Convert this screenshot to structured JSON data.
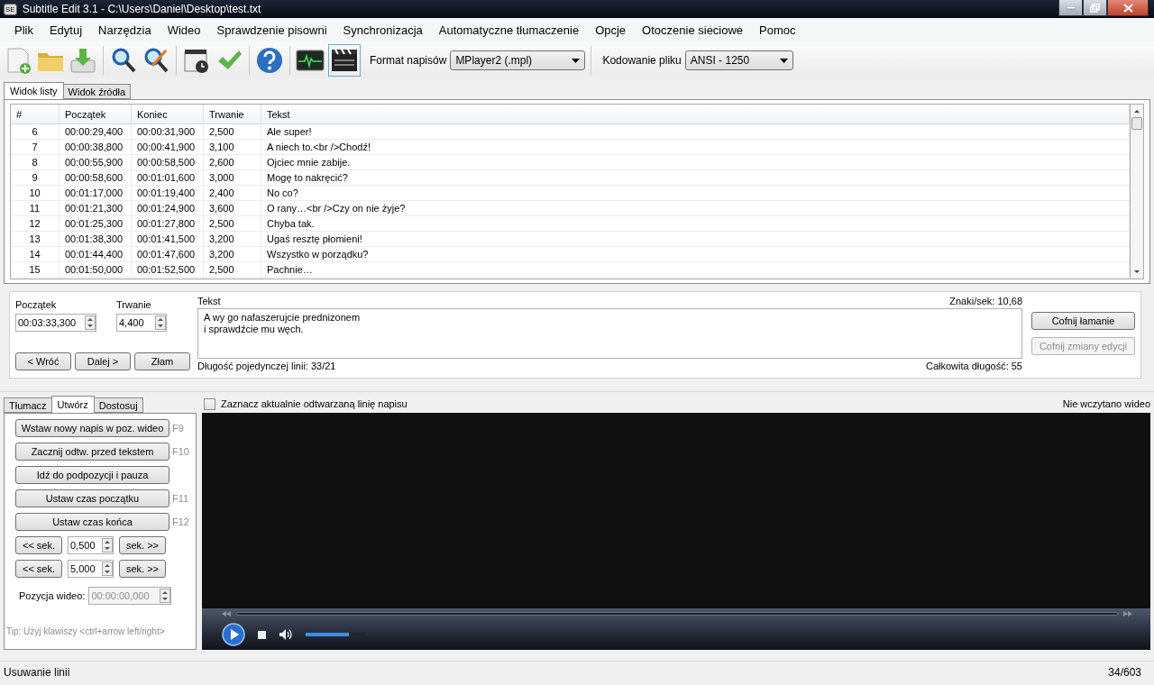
{
  "window": {
    "app_icon": "SE",
    "title": "Subtitle Edit 3.1 - C:\\Users\\Daniel\\Desktop\\test.txt"
  },
  "menu": [
    "Plik",
    "Edytuj",
    "Narzędzia",
    "Wideo",
    "Sprawdzenie pisowni",
    "Synchronizacja",
    "Automatyczne tłumaczenie",
    "Opcje",
    "Otoczenie sieciowe",
    "Pomoc"
  ],
  "toolbar": {
    "format_label": "Format napisów",
    "format_value": "MPlayer2 (.mpl)",
    "encoding_label": "Kodowanie pliku",
    "encoding_value": "ANSI - 1250"
  },
  "view_tabs": [
    {
      "label": "Widok listy",
      "selected": true
    },
    {
      "label": "Widok źródła",
      "selected": false
    }
  ],
  "table": {
    "columns": [
      "#",
      "Początek",
      "Koniec",
      "Trwanie",
      "Tekst"
    ],
    "rows": [
      [
        "6",
        "00:00:29,400",
        "00:00:31,900",
        "2,500",
        "Ale super!"
      ],
      [
        "7",
        "00:00:38,800",
        "00:00:41,900",
        "3,100",
        "A niech to.<br />Chodź!"
      ],
      [
        "8",
        "00:00:55,900",
        "00:00:58,500",
        "2,600",
        "Ojciec mnie zabije."
      ],
      [
        "9",
        "00:00:58,600",
        "00:01:01,600",
        "3,000",
        "Mogę to nakręcić?"
      ],
      [
        "10",
        "00:01:17,000",
        "00:01:19,400",
        "2,400",
        "No co?"
      ],
      [
        "11",
        "00:01:21,300",
        "00:01:24,900",
        "3,600",
        "O rany…<br />Czy on nie żyje?"
      ],
      [
        "12",
        "00:01:25,300",
        "00:01:27,800",
        "2,500",
        "Chyba tak."
      ],
      [
        "13",
        "00:01:38,300",
        "00:01:41,500",
        "3,200",
        "Ugaś resztę płomieni!"
      ],
      [
        "14",
        "00:01:44,400",
        "00:01:47,600",
        "3,200",
        "Wszystko w porządku?"
      ],
      [
        "15",
        "00:01:50,000",
        "00:01:52,500",
        "2,500",
        "Pachnie…"
      ]
    ]
  },
  "editor": {
    "start_label": "Początek",
    "start_value": "00:03:33,300",
    "duration_label": "Trwanie",
    "duration_value": "4,400",
    "text_label": "Tekst",
    "chars_per_sec": "Znaki/sek: 10,68",
    "text_value": "A wy go nafaszerujcie prednizonem\ni sprawdźcie mu węch.",
    "line_lengths": "Długość pojedynczej linii: 33/21",
    "total_length": "Całkowita długość: 55",
    "nav_buttons": [
      "< Wróć",
      "Dalej >",
      "Złam"
    ],
    "side_buttons": [
      {
        "label": "Cofnij łamanie",
        "disabled": false
      },
      {
        "label": "Cofnij zmiany edycji",
        "disabled": true
      }
    ]
  },
  "tool_tabs": [
    {
      "label": "Tłumacz",
      "selected": false
    },
    {
      "label": "Utwórz",
      "selected": true
    },
    {
      "label": "Dostosuj",
      "selected": false
    }
  ],
  "create": {
    "buttons": [
      {
        "label": "Wstaw nowy napis w poz. wideo",
        "shortcut": "F9"
      },
      {
        "label": "Zacznij odtw. przed tekstem",
        "shortcut": "F10"
      },
      {
        "label": "Idź do podpozycji i pauza"
      },
      {
        "label": "Ustaw czas początku",
        "shortcut": "F11"
      },
      {
        "label": "Ustaw czas końca",
        "shortcut": "F12"
      }
    ],
    "steps": [
      {
        "back": "<< sek.",
        "value": "0,500",
        "forward": "sek. >>"
      },
      {
        "back": "<< sek.",
        "value": "5,000",
        "forward": "sek. >>"
      }
    ],
    "position_label": "Pozycja wideo:",
    "position_value": "00:00:00,000",
    "position_disabled": true,
    "tip": "Tip: Użyj klawiszy <ctrl+arrow left/right>"
  },
  "video": {
    "highlight_label": "Zaznacz aktualnie odtwarzaną linię napisu",
    "highlight_checked": false,
    "status": "Nie wczytano wideo",
    "volume": {
      "level": 0.72
    }
  },
  "status_bar": {
    "left": "Usuwanie linii",
    "right": "34/603"
  }
}
